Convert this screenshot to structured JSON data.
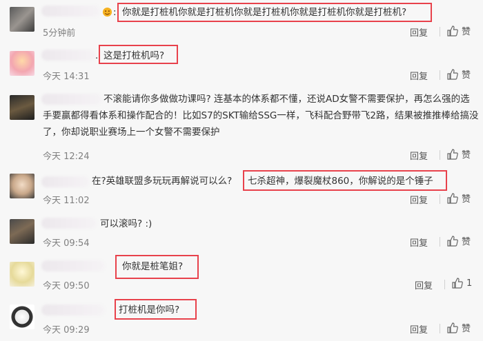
{
  "comments": [
    {
      "text": "你就是打桩机你就是打桩机你就是打桩机你就是打桩机你就是打桩机?",
      "time": "5分钟前",
      "reply": "回复",
      "like": "赞"
    },
    {
      "text": "这是打桩机吗?",
      "time": "今天 14:31",
      "reply": "回复",
      "like": "赞"
    },
    {
      "text": "不滚能请你多做做功课吗? 连基本的体系都不懂，还说AD女警不需要保护，再怎么强的选手要赢都得看体系和操作配合的！比如S7的SKT输给SSG一样，飞科配合野带飞2路，结果被推推棒给搞没了，你却说职业赛场上一个女警不需要保护",
      "time": "今天 12:24",
      "reply": "回复",
      "like": "赞"
    },
    {
      "text_pre": "在?英雄联盟多玩玩再解说可以么?",
      "text_hl": "七杀超神，爆裂魔杖860，你解说的是个锤子",
      "time": "今天 11:02",
      "reply": "回复",
      "like": "赞"
    },
    {
      "text": "可以滚吗? :)",
      "time": "今天 09:54",
      "reply": "回复",
      "like": "赞"
    },
    {
      "text": "你就是桩笔姐?",
      "time": "今天 09:50",
      "reply": "回复",
      "like": "1"
    },
    {
      "text": "打桩机是你吗?",
      "time": "今天 09:29",
      "reply": "回复",
      "like": "赞"
    }
  ],
  "colors": {
    "highlight": "#e8414b",
    "background": "#f7f7f7",
    "meta": "#808080"
  },
  "icons": [
    "thumb-up-icon",
    "emoji-icon"
  ]
}
